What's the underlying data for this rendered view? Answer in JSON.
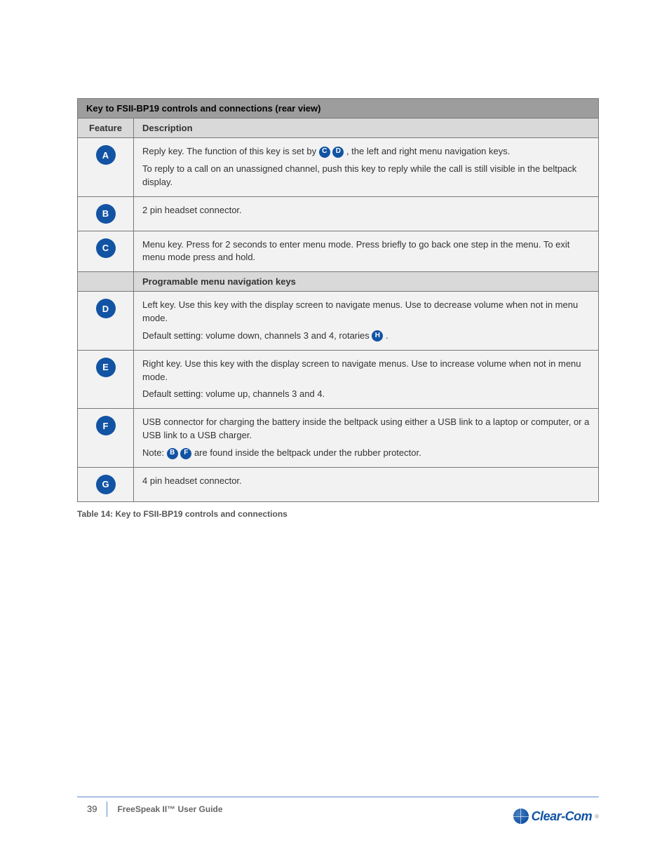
{
  "table": {
    "title": "Key to FSII-BP19 controls and connections (rear view)",
    "headers": {
      "feature": "Feature",
      "description": "Description"
    },
    "rows": [
      {
        "num": "A",
        "line1_pre": "Reply key. The function of this key is set by ",
        "ref1": "C",
        "ref2": "D",
        "line1_post": ", the left and right menu navigation keys.",
        "line2": "To reply to a call on an unassigned channel, push this key to reply while the call is still visible in the beltpack display."
      },
      {
        "num": "B",
        "line1": "2 pin headset connector."
      },
      {
        "num": "C",
        "line1": "Menu key. Press for 2 seconds to enter menu mode. Press briefly to go back one step in the menu. To exit menu mode press and hold."
      }
    ],
    "navHeader": "Programable menu navigation keys",
    "navRows": [
      {
        "num": "D",
        "line1": "Left key. Use this key with the display screen to navigate menus. Use to decrease volume when not in menu mode.",
        "line2_pre": "Default setting: volume down, channels 3 and 4, rotaries ",
        "ref": "H",
        "line2_post": "."
      },
      {
        "num": "E",
        "line1": "Right key. Use this key with the display screen to navigate menus. Use to increase volume when not in menu mode.",
        "line2": "Default setting: volume up, channels 3 and 4."
      },
      {
        "num": "F",
        "line1": "USB connector for charging the battery inside the beltpack using either a USB link to a laptop or computer, or a USB link to a USB charger.",
        "line2_pre": "Note: ",
        "ref1": "B",
        "ref2": "F",
        "line2_post": " are found inside the beltpack under the rubber protector."
      },
      {
        "num": "G",
        "line1": "4 pin headset connector."
      }
    ]
  },
  "caption": "Table 14: Key to FSII-BP19 controls and connections",
  "footer": {
    "page": "39",
    "doc": "FreeSpeak II™ User Guide"
  },
  "logo": {
    "text": "Clear-Com"
  }
}
